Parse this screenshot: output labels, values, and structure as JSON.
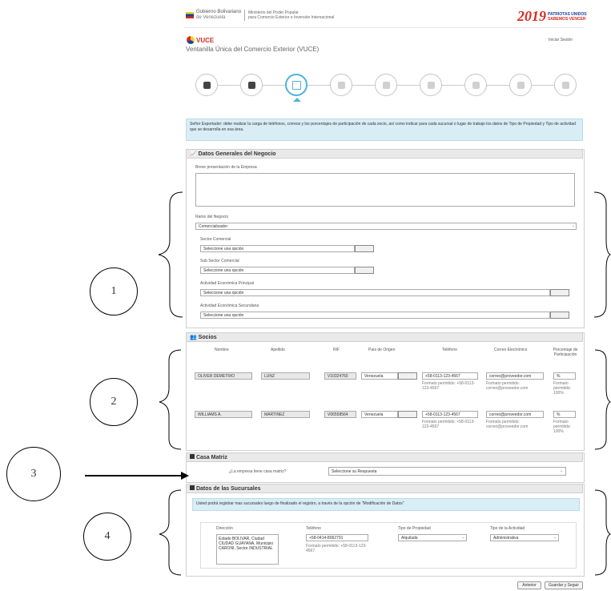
{
  "header": {
    "gov_title": "Gobierno Bolivariano",
    "gov_sub": "de Venezuela",
    "ministry": "Ministerio del Poder Popular",
    "ministry_sub": "para Comercio Exterior e Inversión Internacional",
    "logo_year": "2019",
    "logo_text_1": "PATRIOTAS UNIDOS",
    "logo_text_2": "SABEMOS VENCER",
    "app_short": "VUCE",
    "app_title": "Ventanilla Única del Comercio Exterior (VUCE)",
    "logout": "Iniciar Sesión"
  },
  "info_banner": "Señor Exportador: debe realizar la carga de teléfonos, correos y los porcentajes de participación de cada socio, así como indicar para cada sucursal o lugar de trabajo los datos de Tipo de Propiedad y Tipo de actividad que se desarrolla en esa área.",
  "general": {
    "title": "Datos Generales del Negocio",
    "desc_label": "Breve presentación de la Empresa",
    "ramo_label": "Ramo del Negocio",
    "ramo_value": "Comercializador",
    "sector_label": "Sector Comercial",
    "sector_value": "Seleccione una opción",
    "subsector_label": "Sub Sector Comercial",
    "subsector_value": "Seleccione una opción",
    "act_principal_label": "Actividad Económica Principal",
    "act_principal_value": "Seleccione una opción",
    "act_secundaria_label": "Actividad Económica Secundaria",
    "act_secundaria_value": "Seleccione una opción"
  },
  "socios": {
    "title": "Socios",
    "columns": [
      "Nombre",
      "Apellido",
      "RIF",
      "País de Origen",
      "Teléfono",
      "Correo Electrónico",
      "Porcentaje de Participación"
    ],
    "rows": [
      {
        "nombre": "OLIVER DEMETRIO",
        "apellido": "LUNZ",
        "rif": "V10324760",
        "pais": "Venezuela",
        "telefono": "+58-0113-123-4567",
        "tel_hint": "Formato permitido: +58-0113-123-4567",
        "correo": "correo@proveedor.com",
        "correo_hint": "Formato permitido: correo@proveedor.com",
        "porcentaje": "%",
        "porc_hint": "Formato permitido: 100%"
      },
      {
        "nombre": "WILLIAMS A.",
        "apellido": "MARTINEZ",
        "rif": "V06558564",
        "pais": "Venezuela",
        "telefono": "+58-0113-123-4567",
        "tel_hint": "Formato permitido: +58-0113-123-4567",
        "correo": "correo@proveedor.com",
        "correo_hint": "Formato permitido: correo@proveedor.com",
        "porcentaje": "%",
        "porc_hint": "Formato permitido: 100%"
      }
    ]
  },
  "casa_matriz": {
    "title": "Casa Matriz",
    "question": "¿La empresa tiene casa matriz?",
    "value": "Seleccione su Respuesta"
  },
  "sucursales": {
    "title": "Datos de las Sucursales",
    "info": "Usted podrá registrar mas sucursales luego de finalizado el registro, a través de la opción de \"Modificación de Datos\"",
    "dir_label": "Dirección",
    "dir_value": "Estado BOLIVAR, Ciudad CIUDAD GUAYANA, Municipio CARONI, Sector INDUSTRIAL",
    "tel_label": "Teléfono",
    "tel_value": "+58-0414-8062791",
    "tel_hint": "Formato permitido: +58-0113-123-4567",
    "prop_label": "Tipo de Propiedad",
    "prop_value": "Alquilada",
    "act_label": "Tipo de la Actividad",
    "act_value": "Administrativa"
  },
  "footer": {
    "back": "Anterior",
    "save": "Guardar y Seguir"
  },
  "annotations": [
    "1",
    "2",
    "3",
    "4"
  ],
  "colors": {
    "accent": "#4fb3d9",
    "info_bg": "#d9edf7",
    "logo_red": "#d52b1e"
  }
}
